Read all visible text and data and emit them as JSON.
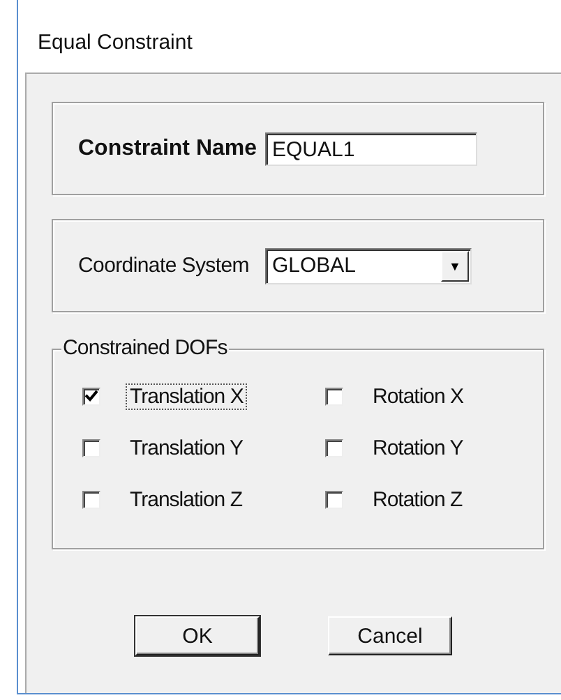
{
  "window": {
    "title": "Equal Constraint"
  },
  "constraint_name": {
    "label": "Constraint Name",
    "value": "EQUAL1"
  },
  "coordinate_system": {
    "label": "Coordinate System",
    "value": "GLOBAL",
    "dropdown_arrow": "▼"
  },
  "constrained_dofs": {
    "title": "Constrained DOFs",
    "items": [
      {
        "label": "Translation X",
        "checked": true,
        "focused": true
      },
      {
        "label": "Rotation X",
        "checked": false,
        "focused": false
      },
      {
        "label": "Translation Y",
        "checked": false,
        "focused": false
      },
      {
        "label": "Rotation Y",
        "checked": false,
        "focused": false
      },
      {
        "label": "Translation Z",
        "checked": false,
        "focused": false
      },
      {
        "label": "Rotation Z",
        "checked": false,
        "focused": false
      }
    ]
  },
  "buttons": [
    {
      "label": "OK"
    },
    {
      "label": "Cancel"
    }
  ]
}
